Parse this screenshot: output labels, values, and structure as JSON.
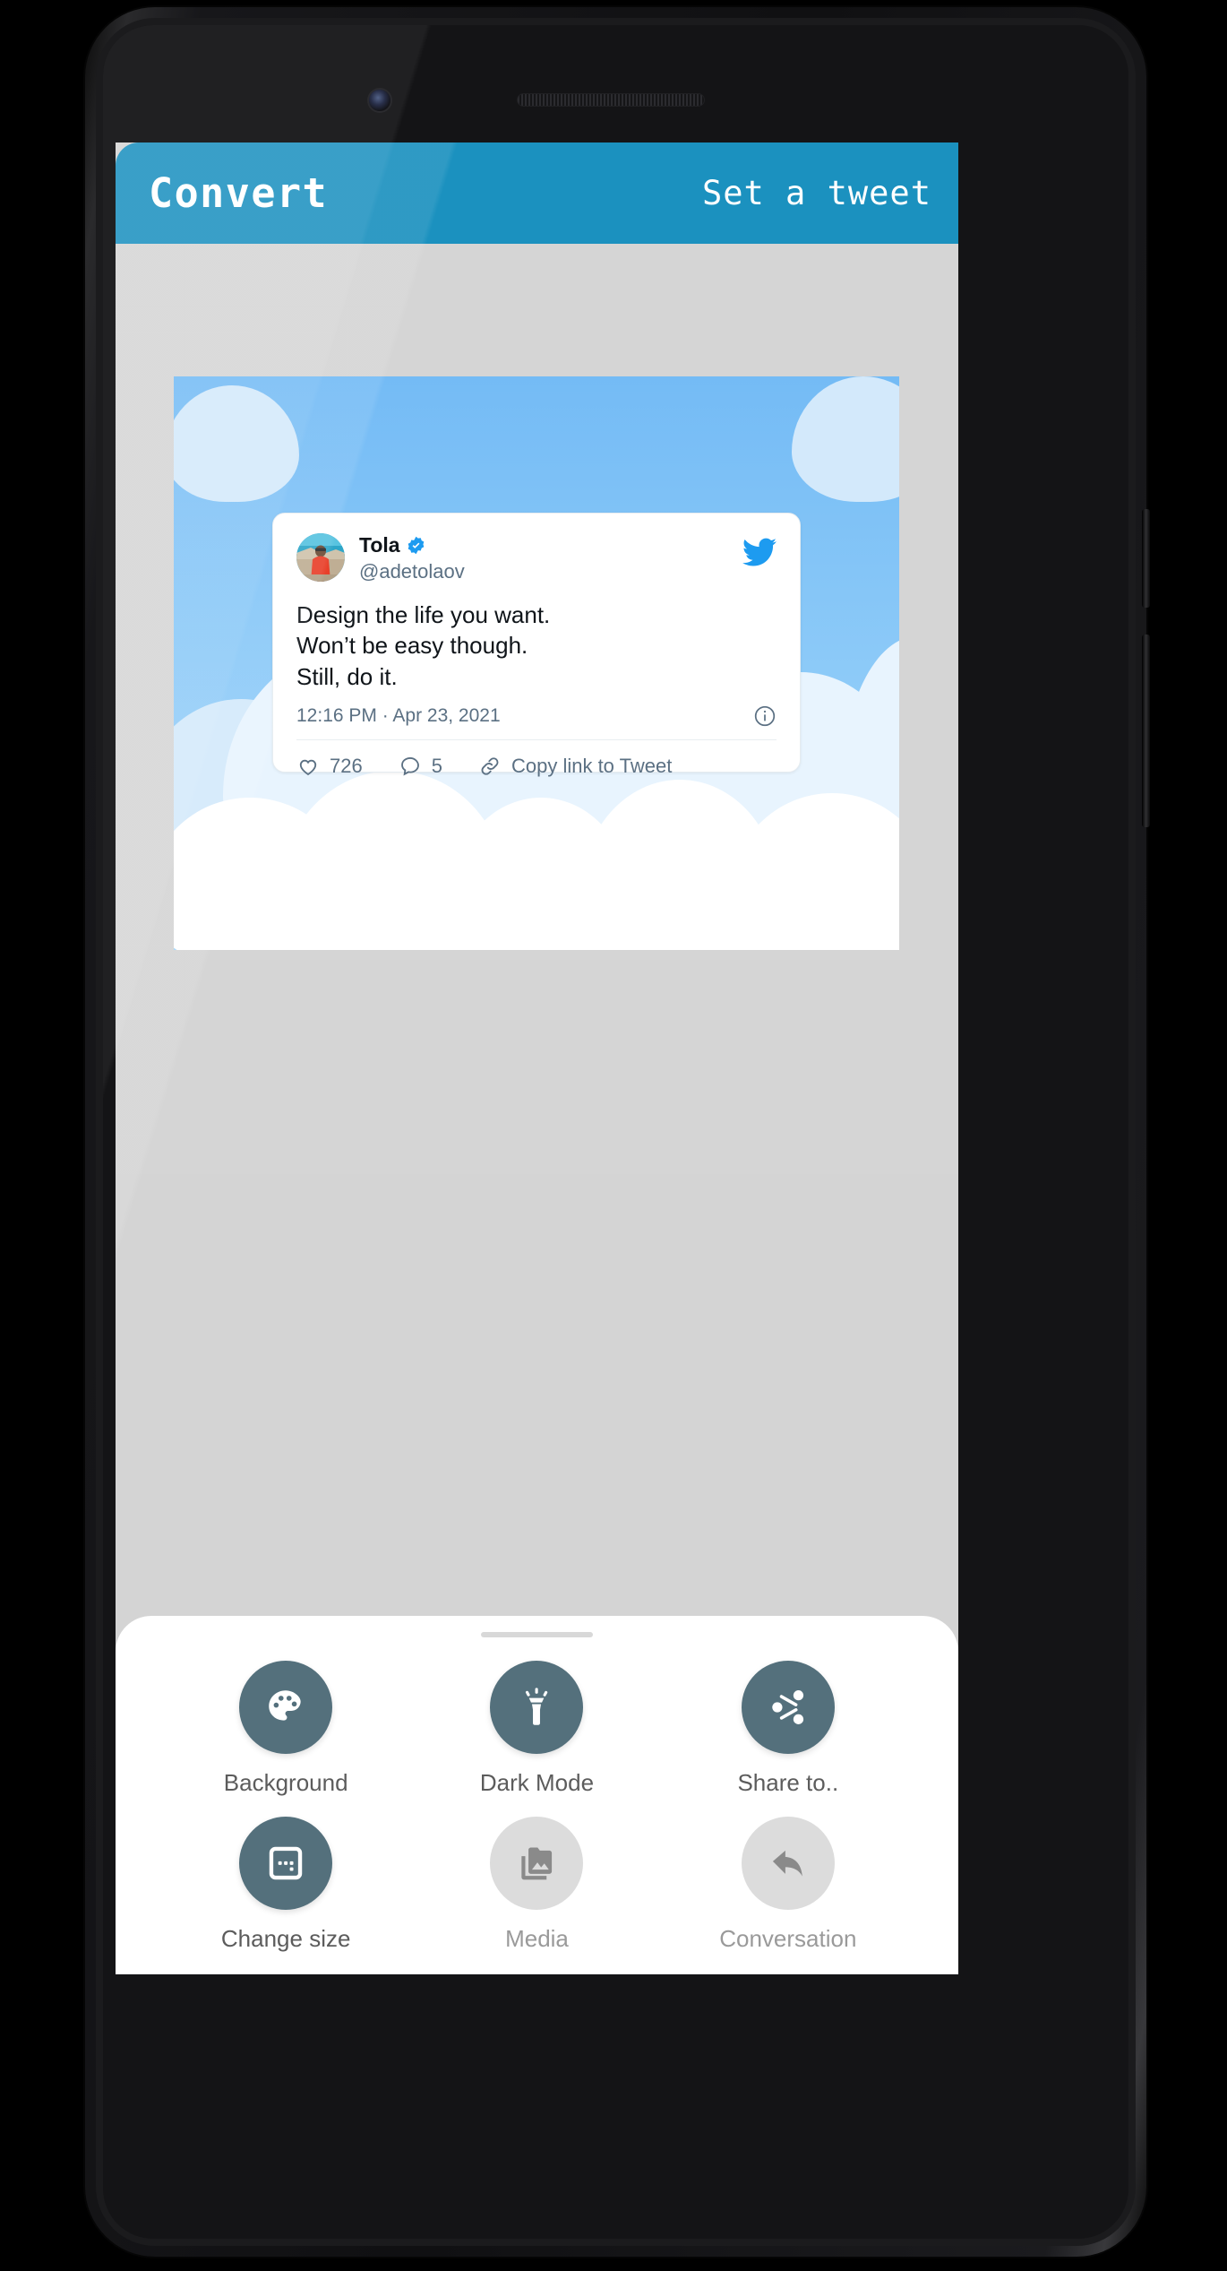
{
  "app": {
    "bar": {
      "title": "Convert",
      "action_label": "Set a tweet",
      "background_color": "#1b91bf"
    }
  },
  "preview": {
    "background_style": "clouds-blue-sky",
    "background_sky_color": "#7ec0f4",
    "tweet": {
      "display_name": "Tola",
      "verified": true,
      "handle": "@adetolaov",
      "avatar_alt": "man in red shirt by the sea",
      "body_lines": [
        "Design the life you want.",
        "Won’t be easy though.",
        "Still, do it."
      ],
      "timestamp": "12:16 PM · Apr 23, 2021",
      "info_icon": "info-circle-icon",
      "brand_icon": "twitter-bird-icon",
      "stats": [
        {
          "icon": "heart-icon",
          "value": "726"
        },
        {
          "icon": "comment-icon",
          "value": "5"
        },
        {
          "icon": "link-icon",
          "value": "Copy link to Tweet"
        }
      ]
    }
  },
  "bottom_sheet": {
    "drag_handle": "sheet-drag-handle",
    "actions": [
      {
        "label": "Background",
        "icon": "palette-icon",
        "enabled": true
      },
      {
        "label": "Dark Mode",
        "icon": "flashlight-icon",
        "enabled": true
      },
      {
        "label": "Share to..",
        "icon": "share-icon",
        "enabled": true
      },
      {
        "label": "Change size",
        "icon": "resize-frame-icon",
        "enabled": true
      },
      {
        "label": "Media",
        "icon": "photo-library-icon",
        "enabled": false
      },
      {
        "label": "Conversation",
        "icon": "reply-arrow-icon",
        "enabled": false
      }
    ],
    "enabled_circle_color": "#54707c",
    "disabled_circle_color": "#dcdcdc"
  },
  "device": {
    "front_camera": "front-camera",
    "earpiece_speaker": "earpiece-speaker"
  }
}
